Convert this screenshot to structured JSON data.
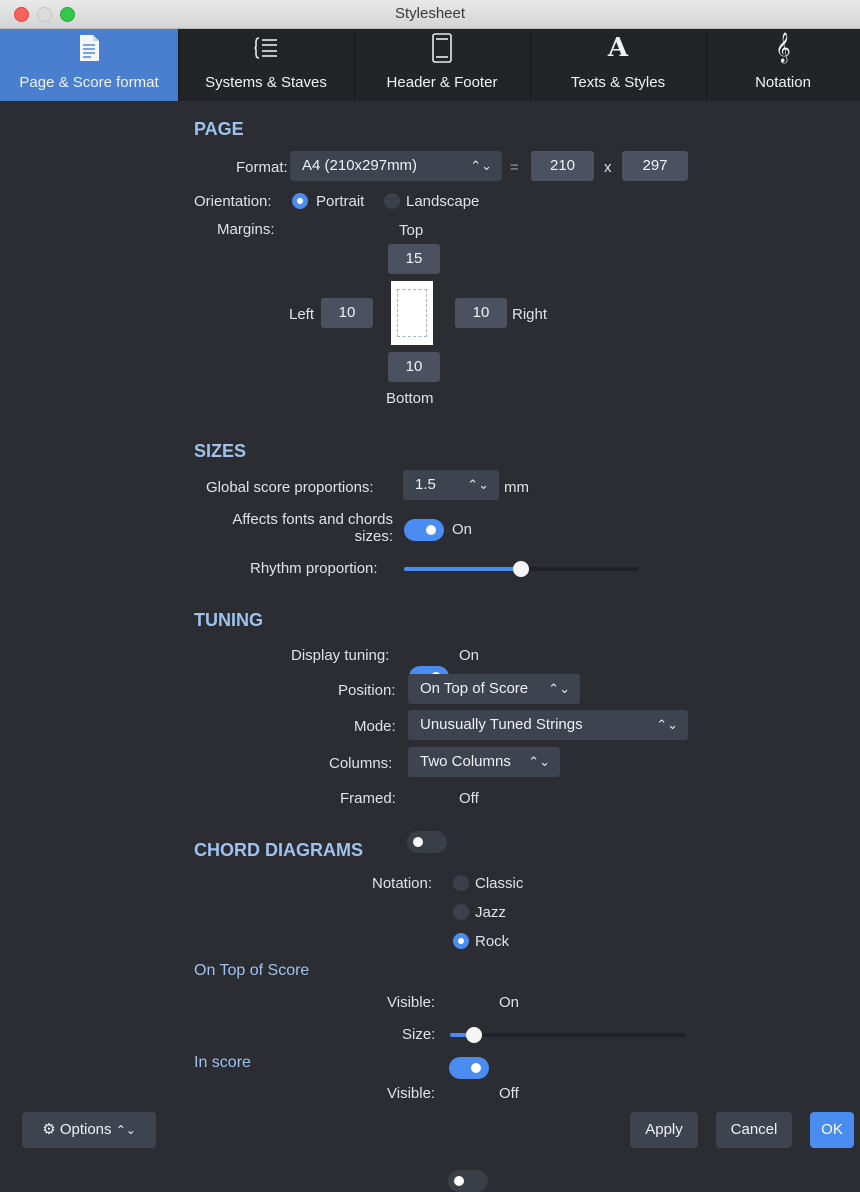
{
  "window": {
    "title": "Stylesheet"
  },
  "tabs": [
    {
      "label": "Page & Score format",
      "icon": "page-icon",
      "active": true
    },
    {
      "label": "Systems & Staves",
      "icon": "systems-icon"
    },
    {
      "label": "Header & Footer",
      "icon": "header-footer-icon"
    },
    {
      "label": "Texts & Styles",
      "icon": "text-a-icon",
      "glyph": "A"
    },
    {
      "label": "Notation",
      "icon": "treble-clef-icon",
      "glyph": "𝄞"
    }
  ],
  "page": {
    "heading": "PAGE",
    "format_label": "Format:",
    "format_value": "A4 (210x297mm)",
    "equals": "=",
    "width": "210",
    "times": "x",
    "height": "297",
    "orientation_label": "Orientation:",
    "portrait": "Portrait",
    "landscape": "Landscape",
    "margins_label": "Margins:",
    "top_label": "Top",
    "top_value": "15",
    "left_label": "Left",
    "left_value": "10",
    "right_label": "Right",
    "right_value": "10",
    "bottom_label": "Bottom",
    "bottom_value": "10"
  },
  "sizes": {
    "heading": "SIZES",
    "global_label": "Global score proportions:",
    "global_value": "1.5",
    "global_unit": "mm",
    "affects_label_1": "Affects fonts and chords",
    "affects_label_2": "sizes:",
    "affects_state": "On",
    "rhythm_label": "Rhythm proportion:",
    "rhythm_level": 0.5
  },
  "tuning": {
    "heading": "TUNING",
    "display_label": "Display tuning:",
    "display_state": "On",
    "position_label": "Position:",
    "position_value": "On Top of Score",
    "mode_label": "Mode:",
    "mode_value": "Unusually Tuned Strings",
    "columns_label": "Columns:",
    "columns_value": "Two Columns",
    "framed_label": "Framed:",
    "framed_state": "Off"
  },
  "chords": {
    "heading": "CHORD DIAGRAMS",
    "notation_label": "Notation:",
    "options": [
      "Classic",
      "Jazz",
      "Rock"
    ],
    "selected": "Rock",
    "top_heading": "On Top of Score",
    "top_visible_label": "Visible:",
    "top_visible_state": "On",
    "top_size_label": "Size:",
    "top_size_level": 0.1,
    "inscore_heading": "In score",
    "inscore_visible_label": "Visible:",
    "inscore_visible_state": "Off"
  },
  "footer": {
    "options_label": "Options",
    "apply_label": "Apply",
    "cancel_label": "Cancel",
    "ok_label": "OK"
  },
  "colors": {
    "accent": "#4a8cf0",
    "active_tab": "#4a7fd0",
    "heading": "#9ec2ee"
  }
}
